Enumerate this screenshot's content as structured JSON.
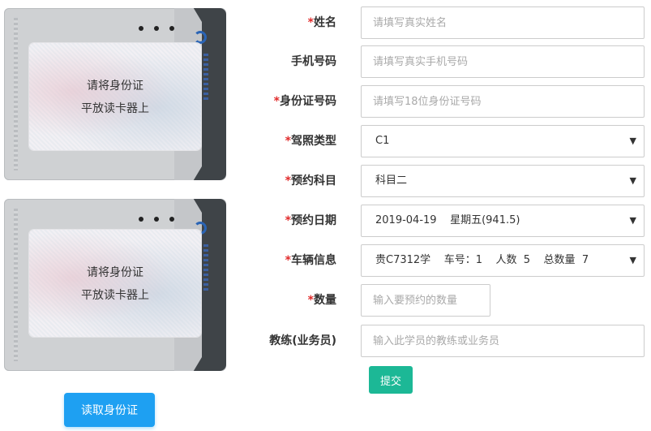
{
  "reader_cards": [
    {
      "line1": "请将身份证",
      "line2": "平放读卡器上"
    },
    {
      "line1": "请将身份证",
      "line2": "平放读卡器上"
    }
  ],
  "read_id_button": "读取身份证",
  "form": {
    "name": {
      "label": "姓名",
      "required": "*",
      "placeholder": "请填写真实姓名"
    },
    "phone": {
      "label": "手机号码",
      "placeholder": "请填写真实手机号码"
    },
    "id_number": {
      "label": "身份证号码",
      "required": "*",
      "placeholder": "请填写18位身份证号码"
    },
    "license_type": {
      "label": "驾照类型",
      "required": "*",
      "value": "C1"
    },
    "subject": {
      "label": "预约科目",
      "required": "*",
      "value": "科目二"
    },
    "date": {
      "label": "预约日期",
      "required": "*",
      "value": "2019-04-19    星期五(941.5)"
    },
    "vehicle": {
      "label": "车辆信息",
      "required": "*",
      "value": "贵C7312学    车号：1    人数  5    总数量  7"
    },
    "quantity": {
      "label": "数量",
      "required": "*",
      "placeholder": "输入要预约的数量"
    },
    "coach": {
      "label": "教练(业务员)",
      "placeholder": "输入此学员的教练或业务员"
    },
    "submit_label": "提交"
  },
  "colors": {
    "required": "#e12b2b",
    "read_button": "#1ea0f2",
    "submit_button": "#1cb896"
  },
  "icons": {
    "dropdown": "caret-down-icon"
  }
}
